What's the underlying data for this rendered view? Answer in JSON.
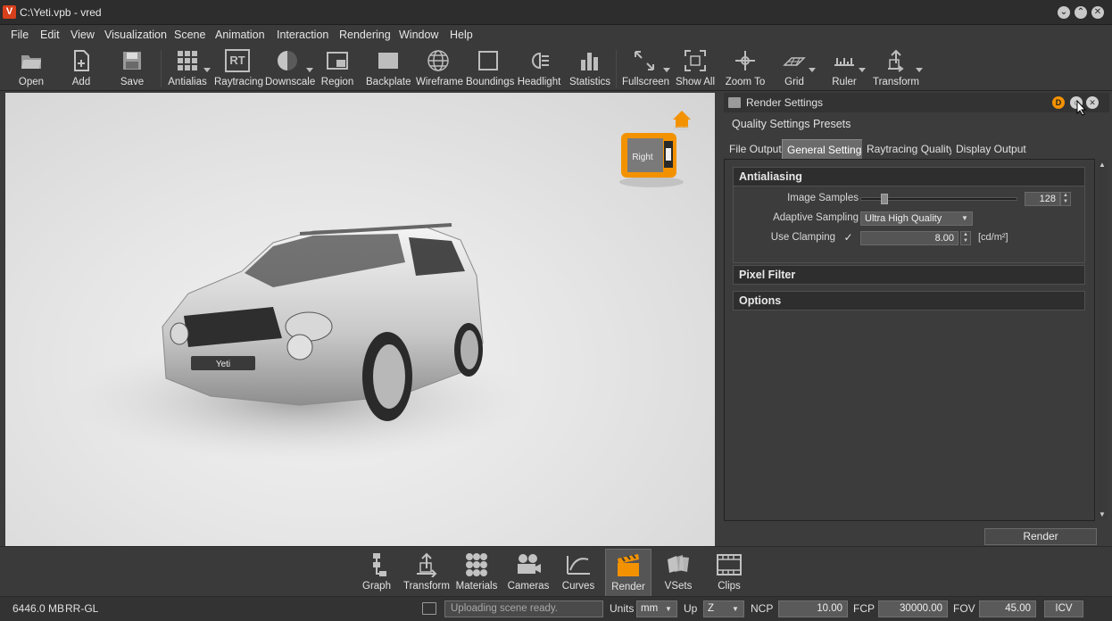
{
  "window": {
    "logo": "V",
    "title": "C:\\Yeti.vpb - vred"
  },
  "menu": [
    "File",
    "Edit",
    "View",
    "Visualization",
    "Scene",
    "Animation",
    "Interaction",
    "Rendering",
    "Window",
    "Help"
  ],
  "toolbar": [
    {
      "label": "Open",
      "icon": "folder-icon"
    },
    {
      "label": "Add",
      "icon": "add-file-icon"
    },
    {
      "label": "Save",
      "icon": "save-icon"
    },
    {
      "label": "Antialias",
      "icon": "antialias-icon"
    },
    {
      "label": "Raytracing",
      "icon": "raytracing-icon",
      "glyph": "RT"
    },
    {
      "label": "Downscale",
      "icon": "downscale-icon"
    },
    {
      "label": "Region",
      "icon": "region-icon"
    },
    {
      "label": "Backplate",
      "icon": "backplate-icon"
    },
    {
      "label": "Wireframe",
      "icon": "wireframe-icon"
    },
    {
      "label": "Boundings",
      "icon": "boundings-icon"
    },
    {
      "label": "Headlight",
      "icon": "headlight-icon"
    },
    {
      "label": "Statistics",
      "icon": "statistics-icon"
    },
    {
      "label": "Fullscreen",
      "icon": "fullscreen-icon"
    },
    {
      "label": "Show All",
      "icon": "show-all-icon"
    },
    {
      "label": "Zoom To",
      "icon": "zoom-to-icon"
    },
    {
      "label": "Grid",
      "icon": "grid-icon"
    },
    {
      "label": "Ruler",
      "icon": "ruler-icon"
    },
    {
      "label": "Transform",
      "icon": "transform-icon"
    }
  ],
  "viewport": {
    "navcube_face": "Right",
    "home_label": "HOME",
    "car_plate": "Yeti"
  },
  "render_settings": {
    "title": "Render Settings",
    "presets_label": "Quality Settings Presets",
    "tabs": [
      "File Output",
      "General Settings",
      "Raytracing Quality",
      "Display Output"
    ],
    "active_tab": "General Settings",
    "antialiasing": {
      "header": "Antialiasing",
      "image_samples_label": "Image Samples",
      "image_samples_value": "128",
      "image_samples_fraction": 0.13,
      "adaptive_label": "Adaptive Sampling",
      "adaptive_value": "Ultra High Quality",
      "clamping_label": "Use Clamping",
      "clamping_checked": true,
      "clamping_value": "8.00",
      "clamping_unit": "[cd/m²]"
    },
    "pixel_filter_header": "Pixel Filter",
    "options_header": "Options",
    "render_button": "Render"
  },
  "dock": [
    {
      "label": "Graph",
      "icon": "graph-icon"
    },
    {
      "label": "Transform",
      "icon": "transform-icon"
    },
    {
      "label": "Materials",
      "icon": "materials-icon"
    },
    {
      "label": "Cameras",
      "icon": "cameras-icon"
    },
    {
      "label": "Curves",
      "icon": "curves-icon"
    },
    {
      "label": "Render",
      "icon": "clapperboard-icon",
      "active": true
    },
    {
      "label": "VSets",
      "icon": "vsets-icon"
    },
    {
      "label": "Clips",
      "icon": "clips-icon"
    }
  ],
  "status": {
    "memory": "6446.0 MB",
    "renderer": "RR-GL",
    "message": "Uploading scene ready.",
    "units_label": "Units",
    "units_value": "mm",
    "up_label": "Up",
    "up_value": "Z",
    "ncp_label": "NCP",
    "ncp_value": "10.00",
    "fcp_label": "FCP",
    "fcp_value": "30000.00",
    "fov_label": "FOV",
    "fov_value": "45.00",
    "icv_label": "ICV"
  },
  "colors": {
    "accent": "#f39200",
    "logo": "#d8401c",
    "bg": "#3c3c3c"
  }
}
